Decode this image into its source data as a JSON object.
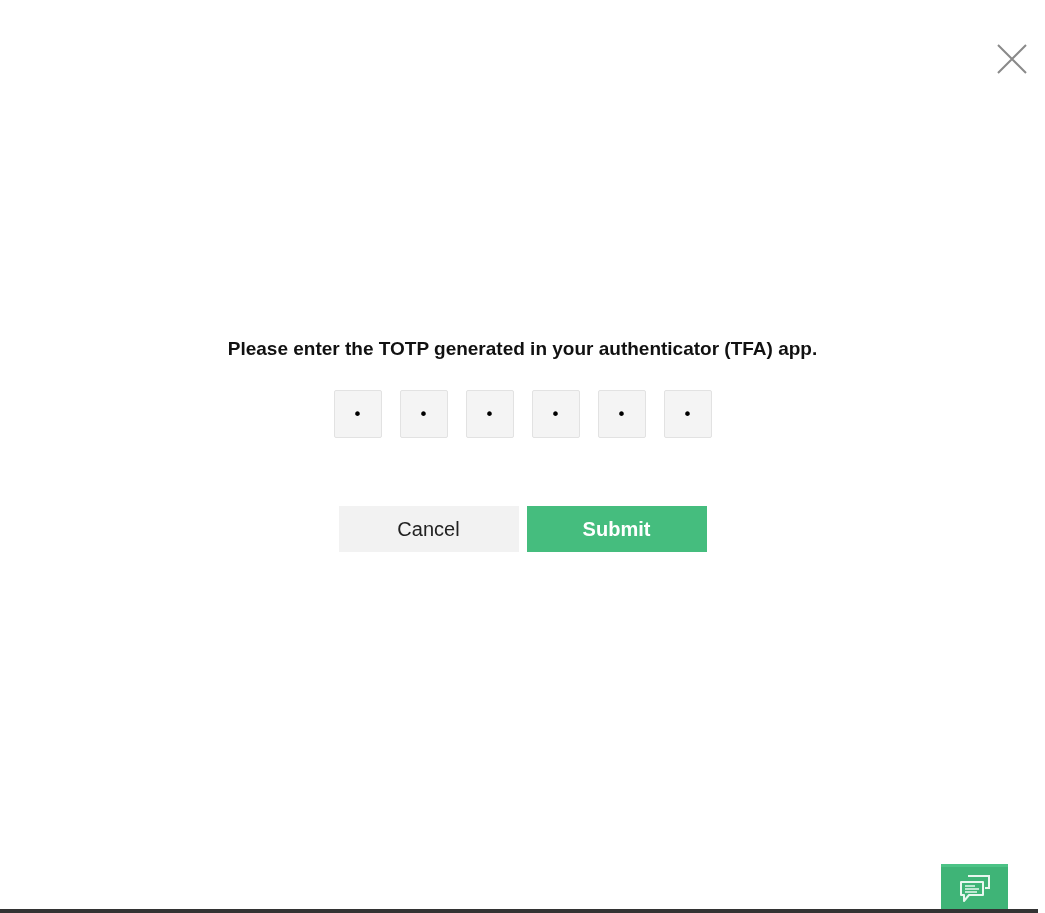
{
  "dialog": {
    "prompt": "Please enter the TOTP generated in your authenticator (TFA) app.",
    "code_digits": [
      {
        "value": "•"
      },
      {
        "value": "•"
      },
      {
        "value": "•"
      },
      {
        "value": "•"
      },
      {
        "value": "•"
      },
      {
        "value": "•"
      }
    ],
    "buttons": [
      {
        "label": "Cancel",
        "kind": "secondary"
      },
      {
        "label": "Submit",
        "kind": "primary"
      }
    ]
  }
}
